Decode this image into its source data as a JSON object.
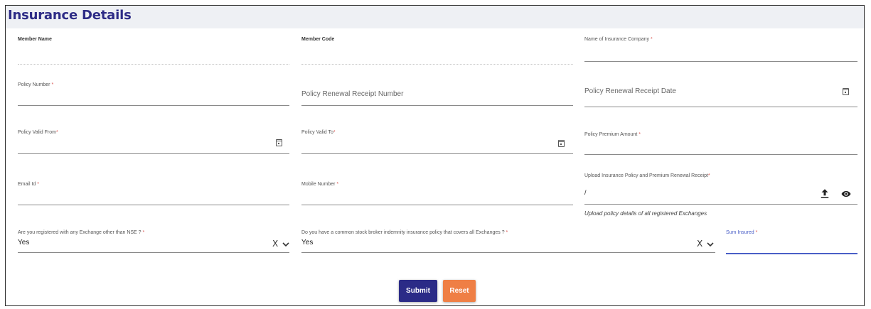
{
  "header": {
    "title": "Insurance Details"
  },
  "colors": {
    "accent": "#2d2b86",
    "required": "#d9534f",
    "submit": "#2b2b87",
    "reset": "#ef7f45",
    "active_line": "#4a5fc7"
  },
  "fields": {
    "member_name": {
      "label": "Member Name",
      "value": ""
    },
    "member_code": {
      "label": "Member Code",
      "value": ""
    },
    "insurance_company": {
      "label": "Name of Insurance Company",
      "required_mark": "*",
      "value": ""
    },
    "policy_number": {
      "label": "Policy Number",
      "required_mark": "*",
      "value": ""
    },
    "renewal_receipt_number": {
      "placeholder": "Policy Renewal Receipt Number"
    },
    "renewal_receipt_date": {
      "placeholder": "Policy Renewal Receipt Date",
      "icon": "calendar-icon"
    },
    "policy_valid_from": {
      "label": "Policy Valid From",
      "required_mark": "*",
      "icon": "calendar-icon"
    },
    "policy_valid_to": {
      "label": "Policy Valid To",
      "required_mark": "*",
      "icon": "calendar-icon"
    },
    "premium_amount": {
      "label": "Policy Premium Amount",
      "required_mark": "*",
      "value": ""
    },
    "email": {
      "label": "Email Id",
      "required_mark": "*",
      "value": ""
    },
    "mobile": {
      "label": "Mobile Number",
      "required_mark": "*",
      "value": ""
    },
    "upload": {
      "label": "Upload Insurance Policy and Premium Renewal Receipt",
      "required_mark": "*",
      "value": "/",
      "hint": "Upload policy details of all registered Exchanges",
      "upload_icon": "upload-icon",
      "view_icon": "eye-icon"
    },
    "other_exchange": {
      "label": "Are you registered with any Exchange other than NSE ?",
      "required_mark": "*",
      "value": "Yes",
      "clear": "X"
    },
    "common_policy": {
      "label": "Do you have a common stock broker indemnity insurance policy that covers all Exchanges ?",
      "required_mark": "*",
      "value": "Yes",
      "clear": "X"
    },
    "sum_insured": {
      "label": "Sum Insured",
      "required_mark": "*",
      "value": ""
    }
  },
  "actions": {
    "submit_label": "Submit",
    "reset_label": "Reset"
  }
}
